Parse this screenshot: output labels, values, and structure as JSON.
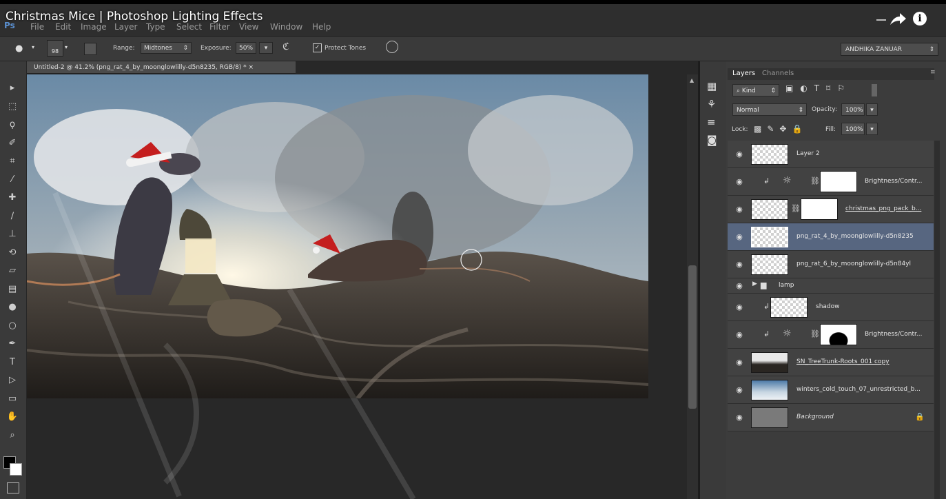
{
  "video": {
    "title": "Christmas Mice | Photoshop Lighting Effects"
  },
  "menu": [
    "File",
    "Edit",
    "Image",
    "Layer",
    "Type",
    "Select",
    "Filter",
    "View",
    "Window",
    "Help"
  ],
  "app_logo": "Ps",
  "options": {
    "brush_size": "98",
    "range_label": "Range:",
    "range_value": "Midtones",
    "exposure_label": "Exposure:",
    "exposure_value": "50%",
    "protect_tones_label": "Protect Tones",
    "protect_tones_checked": true,
    "user": "ANDHIKA ZANUAR"
  },
  "document": {
    "tab_title": "Untitled-2 @ 41.2% (png_rat_4_by_moonglowlilly-d5n8235, RGB/8) * ×"
  },
  "tools": [
    "move-icon",
    "marquee-icon",
    "lasso-icon",
    "quick-select-icon",
    "crop-icon",
    "eyedropper-icon",
    "healing-icon",
    "brush-icon",
    "stamp-icon",
    "history-brush-icon",
    "eraser-icon",
    "gradient-icon",
    "blur-icon",
    "dodge-icon",
    "pen-icon",
    "type-icon",
    "path-select-icon",
    "shape-icon",
    "hand-icon",
    "zoom-icon"
  ],
  "layers_panel": {
    "tabs": [
      "Layers",
      "Channels"
    ],
    "kind_label": "Kind",
    "blend_mode": "Normal",
    "opacity_label": "Opacity:",
    "opacity_value": "100%",
    "lock_label": "Lock:",
    "fill_label": "Fill:",
    "fill_value": "100%",
    "layers": [
      {
        "name": "Layer 2",
        "type": "pixel"
      },
      {
        "name": "Brightness/Contr...",
        "type": "adjustment",
        "clipped": true
      },
      {
        "name": "christmas_png_pack_b...",
        "type": "masked"
      },
      {
        "name": "png_rat_4_by_moonglowlilly-d5n8235",
        "type": "pixel",
        "selected": true
      },
      {
        "name": "png_rat_6_by_moonglowlilly-d5n84yl",
        "type": "pixel"
      },
      {
        "name": "lamp",
        "type": "group"
      },
      {
        "name": "shadow",
        "type": "pixel",
        "clipped": true
      },
      {
        "name": "Brightness/Contr...",
        "type": "adjustment",
        "clipped": true
      },
      {
        "name": "SN_TreeTrunk-Roots_001 copy",
        "type": "pixel"
      },
      {
        "name": "winters_cold_touch_07_unrestricted_b...",
        "type": "pixel"
      },
      {
        "name": "Background",
        "type": "background",
        "locked": true
      }
    ]
  },
  "colors": {
    "selected_layer": "#576680",
    "panel": "#3c3c3c",
    "accent": "#5a8fcf"
  }
}
